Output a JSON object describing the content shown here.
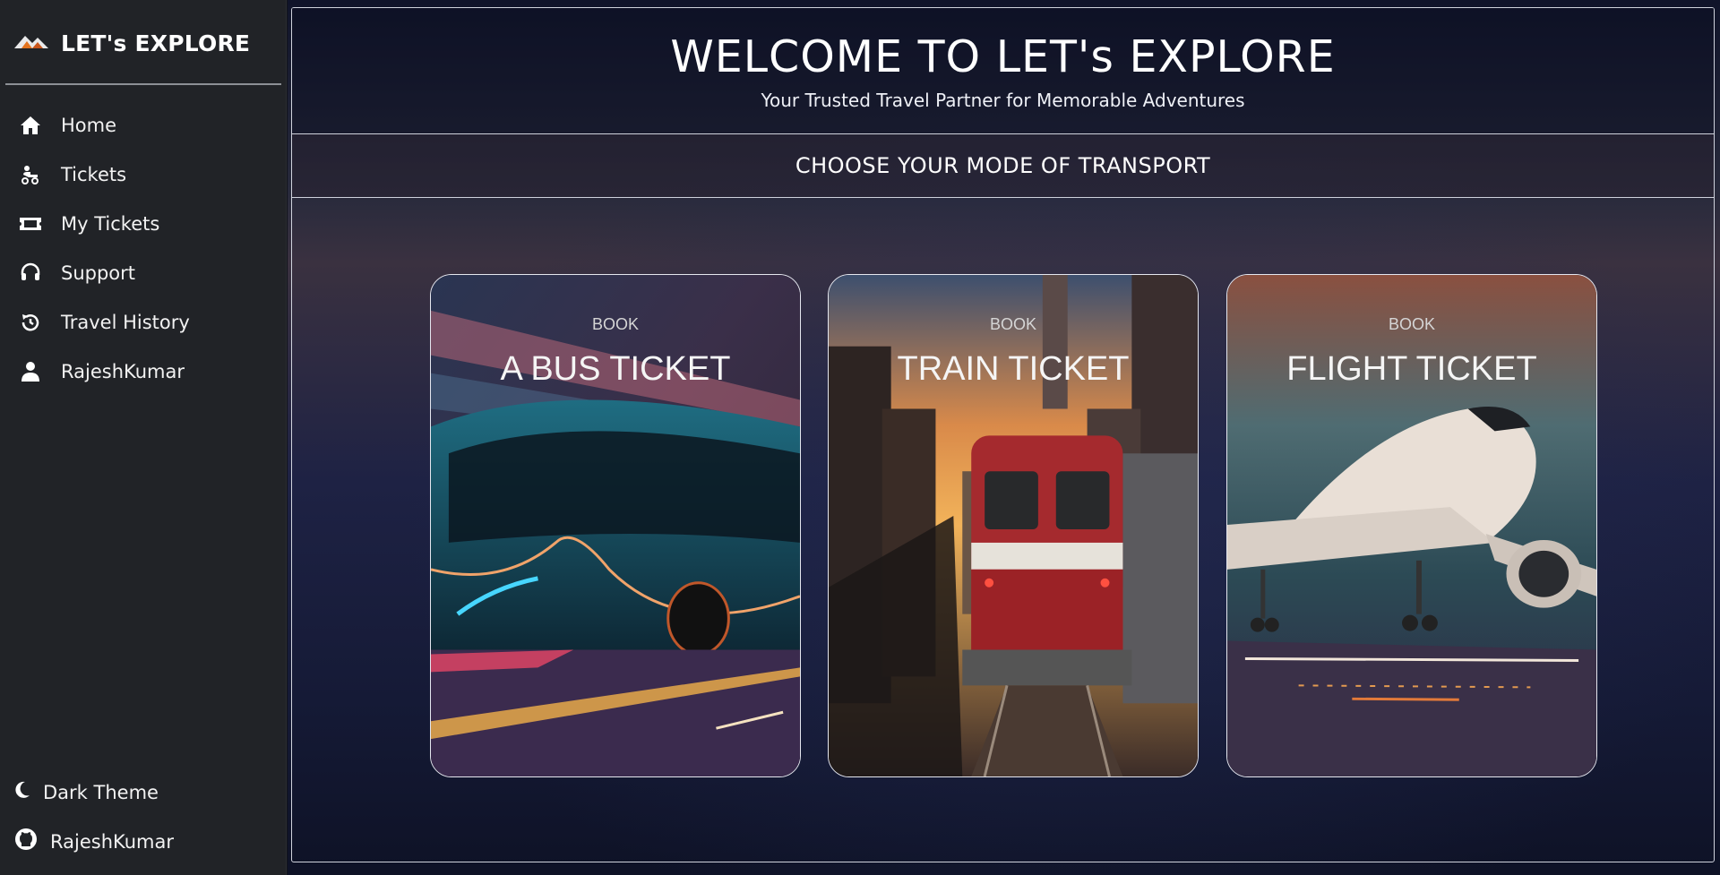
{
  "brand": {
    "title": "LET's EXPLORE",
    "logo_icon": "mountain-logo-icon"
  },
  "nav": [
    {
      "label": "Home",
      "icon": "home-icon"
    },
    {
      "label": "Tickets",
      "icon": "tickets-icon"
    },
    {
      "label": "My Tickets",
      "icon": "ticket-icon"
    },
    {
      "label": "Support",
      "icon": "headset-icon"
    },
    {
      "label": "Travel History",
      "icon": "history-icon"
    },
    {
      "label": "RajeshKumar",
      "icon": "user-icon"
    }
  ],
  "sidebar_bottom": {
    "theme_label": "Dark Theme",
    "theme_icon": "moon-icon",
    "github_label": "RajeshKumar",
    "github_icon": "github-icon"
  },
  "header": {
    "title": "WELCOME TO LET's EXPLORE",
    "subtitle": "Your Trusted Travel Partner for Memorable Adventures"
  },
  "mode_title": "CHOOSE YOUR MODE OF TRANSPORT",
  "cards": [
    {
      "kicker": "BOOK",
      "title": "A BUS TICKET"
    },
    {
      "kicker": "BOOK",
      "title": "TRAIN TICKET"
    },
    {
      "kicker": "BOOK",
      "title": "FLIGHT TICKET"
    }
  ],
  "colors": {
    "sidebar_bg": "#212327",
    "main_bg": "#151a36",
    "border": "#cfd2dc"
  }
}
